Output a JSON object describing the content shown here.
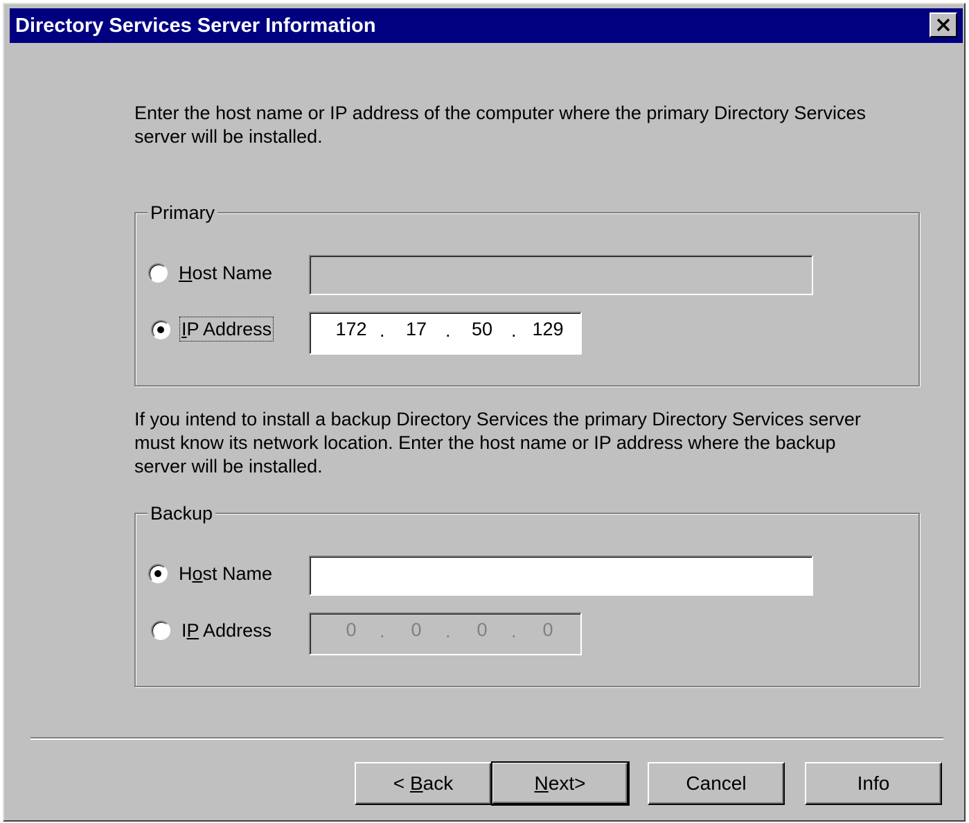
{
  "window": {
    "title": "Directory Services Server Information",
    "close_icon": "close-icon"
  },
  "intro_text": {
    "line1": "Enter the host name or IP address of the computer where the  primary Directory Services",
    "line2": "server will be installed."
  },
  "primary": {
    "label": "Primary",
    "host_radio": {
      "pre": "",
      "ul": "H",
      "post": "ost Name",
      "checked": false
    },
    "host_value": "",
    "ip_radio": {
      "pre": "",
      "ul": "I",
      "post": "P Address",
      "checked": true
    },
    "ip": [
      "172",
      "17",
      "50",
      "129"
    ]
  },
  "backup_text": {
    "line1": "If you intend to install a backup Directory Services the primary Directory Services server",
    "line2": "must know its network location.  Enter the host name or IP address where the backup",
    "line3": "server will be installed."
  },
  "backup": {
    "label": "Backup",
    "host_radio": {
      "pre": "H",
      "ul": "o",
      "post": "st Name",
      "checked": true
    },
    "host_value": "",
    "ip_radio": {
      "pre": "I",
      "ul": "P",
      "post": " Address",
      "checked": false
    },
    "ip": [
      "0",
      "0",
      "0",
      "0"
    ]
  },
  "buttons": {
    "back": {
      "pre": "< ",
      "ul": "B",
      "post": "ack"
    },
    "next": {
      "pre": "",
      "ul": "N",
      "post": "ext>"
    },
    "cancel": "Cancel",
    "info": "Info"
  },
  "colors": {
    "titlebar": "#000080",
    "face": "#c0c0c0"
  }
}
